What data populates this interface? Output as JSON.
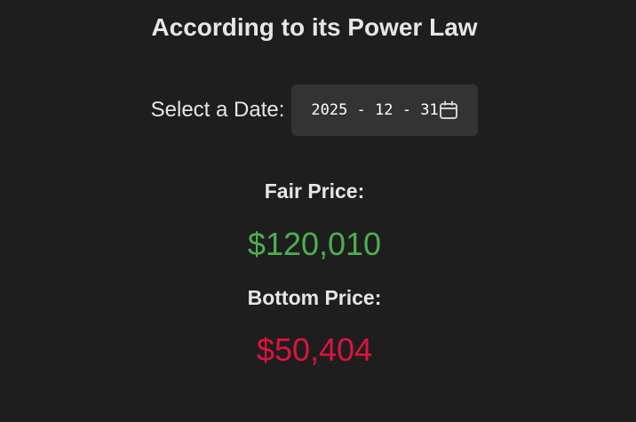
{
  "header": {
    "title": "According to its Power Law"
  },
  "date_picker": {
    "label": "Select a Date:",
    "value": "2025 - 12 - 31",
    "icon": "calendar-icon"
  },
  "fair_price": {
    "label": "Fair Price:",
    "value": "$120,010",
    "color": "#4caf50"
  },
  "bottom_price": {
    "label": "Bottom Price:",
    "value": "$50,404",
    "color": "#dc143c"
  }
}
